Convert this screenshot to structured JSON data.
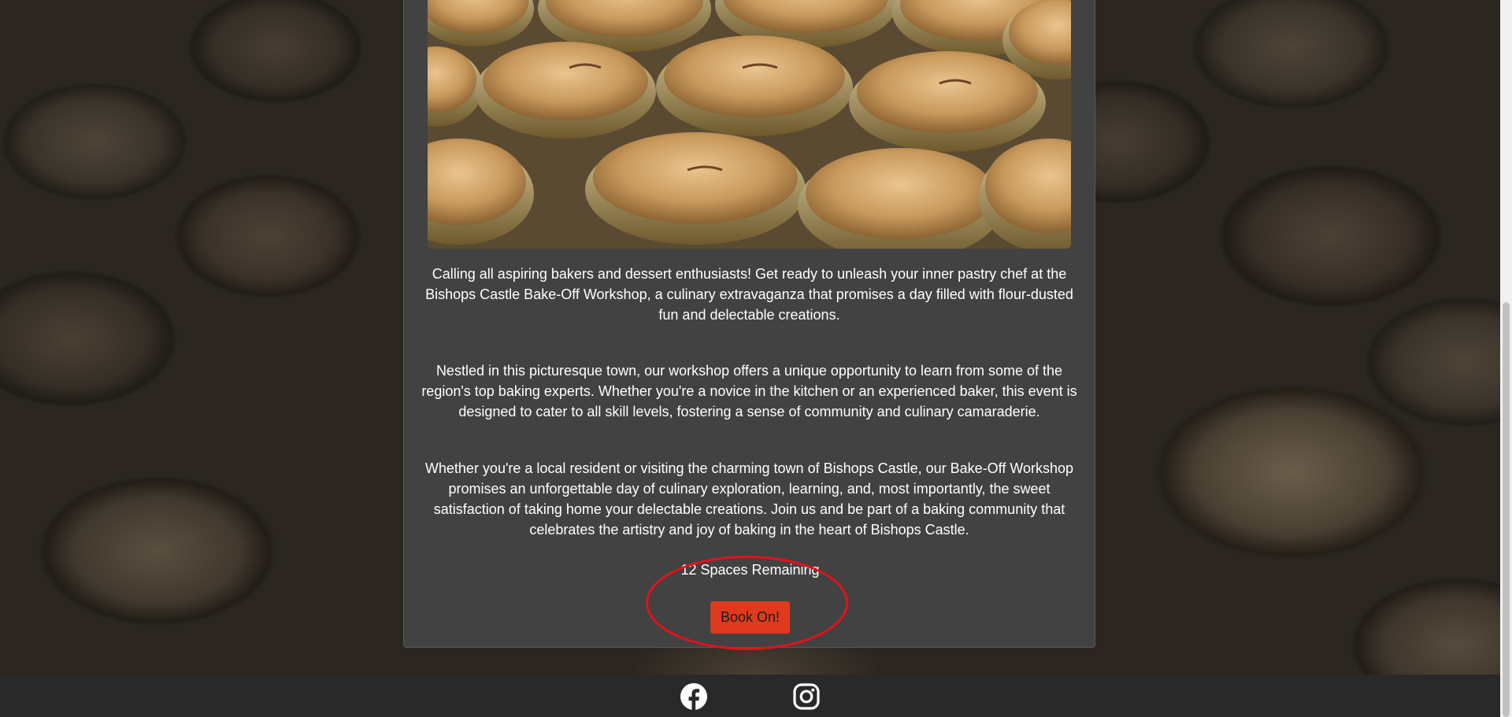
{
  "event": {
    "paragraphs": [
      "Calling all aspiring bakers and dessert enthusiasts! Get ready to unleash your inner pastry chef at the Bishops Castle Bake-Off Workshop, a culinary extravaganza that promises a day filled with flour-dusted fun and delectable creations.",
      "Nestled in this picturesque town, our workshop offers a unique opportunity to learn from some of the region's top baking experts. Whether you're a novice in the kitchen or an experienced baker, this event is designed to cater to all skill levels, fostering a sense of community and culinary camaraderie.",
      "Whether you're a local resident or visiting the charming town of Bishops Castle, our Bake-Off Workshop promises an unforgettable day of culinary exploration, learning, and, most importantly, the sweet satisfaction of taking home your delectable creations. Join us and be part of a baking community that celebrates the artistry and joy of baking in the heart of Bishops Castle."
    ],
    "spaces_remaining": "12 Spaces Remaining",
    "book_button_label": "Book On!"
  },
  "footer": {
    "icons": [
      "facebook-icon",
      "instagram-icon"
    ]
  },
  "colors": {
    "card_background": "#424242",
    "button_background": "#e03a1e",
    "highlight_ring": "#e8101c",
    "footer_background": "#292929"
  }
}
